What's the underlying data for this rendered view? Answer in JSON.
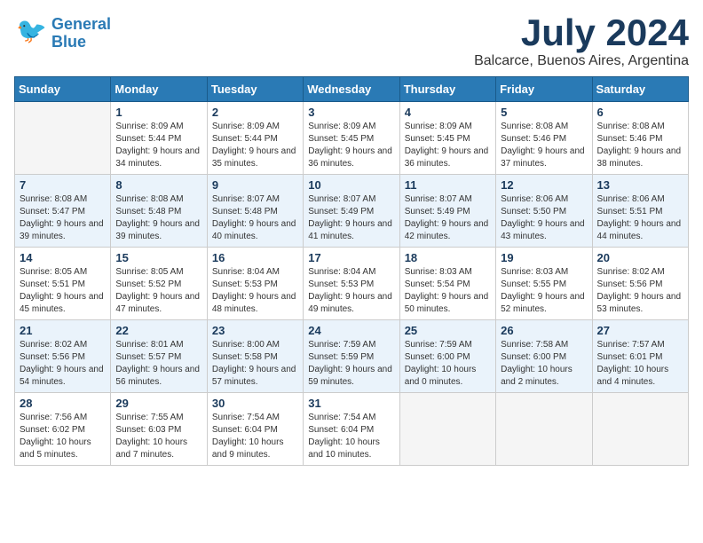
{
  "header": {
    "logo_line1": "General",
    "logo_line2": "Blue",
    "month": "July 2024",
    "location": "Balcarce, Buenos Aires, Argentina"
  },
  "weekdays": [
    "Sunday",
    "Monday",
    "Tuesday",
    "Wednesday",
    "Thursday",
    "Friday",
    "Saturday"
  ],
  "weeks": [
    [
      {
        "day": "",
        "sunrise": "",
        "sunset": "",
        "daylight": ""
      },
      {
        "day": "1",
        "sunrise": "Sunrise: 8:09 AM",
        "sunset": "Sunset: 5:44 PM",
        "daylight": "Daylight: 9 hours and 34 minutes."
      },
      {
        "day": "2",
        "sunrise": "Sunrise: 8:09 AM",
        "sunset": "Sunset: 5:44 PM",
        "daylight": "Daylight: 9 hours and 35 minutes."
      },
      {
        "day": "3",
        "sunrise": "Sunrise: 8:09 AM",
        "sunset": "Sunset: 5:45 PM",
        "daylight": "Daylight: 9 hours and 36 minutes."
      },
      {
        "day": "4",
        "sunrise": "Sunrise: 8:09 AM",
        "sunset": "Sunset: 5:45 PM",
        "daylight": "Daylight: 9 hours and 36 minutes."
      },
      {
        "day": "5",
        "sunrise": "Sunrise: 8:08 AM",
        "sunset": "Sunset: 5:46 PM",
        "daylight": "Daylight: 9 hours and 37 minutes."
      },
      {
        "day": "6",
        "sunrise": "Sunrise: 8:08 AM",
        "sunset": "Sunset: 5:46 PM",
        "daylight": "Daylight: 9 hours and 38 minutes."
      }
    ],
    [
      {
        "day": "7",
        "sunrise": "Sunrise: 8:08 AM",
        "sunset": "Sunset: 5:47 PM",
        "daylight": "Daylight: 9 hours and 39 minutes."
      },
      {
        "day": "8",
        "sunrise": "Sunrise: 8:08 AM",
        "sunset": "Sunset: 5:48 PM",
        "daylight": "Daylight: 9 hours and 39 minutes."
      },
      {
        "day": "9",
        "sunrise": "Sunrise: 8:07 AM",
        "sunset": "Sunset: 5:48 PM",
        "daylight": "Daylight: 9 hours and 40 minutes."
      },
      {
        "day": "10",
        "sunrise": "Sunrise: 8:07 AM",
        "sunset": "Sunset: 5:49 PM",
        "daylight": "Daylight: 9 hours and 41 minutes."
      },
      {
        "day": "11",
        "sunrise": "Sunrise: 8:07 AM",
        "sunset": "Sunset: 5:49 PM",
        "daylight": "Daylight: 9 hours and 42 minutes."
      },
      {
        "day": "12",
        "sunrise": "Sunrise: 8:06 AM",
        "sunset": "Sunset: 5:50 PM",
        "daylight": "Daylight: 9 hours and 43 minutes."
      },
      {
        "day": "13",
        "sunrise": "Sunrise: 8:06 AM",
        "sunset": "Sunset: 5:51 PM",
        "daylight": "Daylight: 9 hours and 44 minutes."
      }
    ],
    [
      {
        "day": "14",
        "sunrise": "Sunrise: 8:05 AM",
        "sunset": "Sunset: 5:51 PM",
        "daylight": "Daylight: 9 hours and 45 minutes."
      },
      {
        "day": "15",
        "sunrise": "Sunrise: 8:05 AM",
        "sunset": "Sunset: 5:52 PM",
        "daylight": "Daylight: 9 hours and 47 minutes."
      },
      {
        "day": "16",
        "sunrise": "Sunrise: 8:04 AM",
        "sunset": "Sunset: 5:53 PM",
        "daylight": "Daylight: 9 hours and 48 minutes."
      },
      {
        "day": "17",
        "sunrise": "Sunrise: 8:04 AM",
        "sunset": "Sunset: 5:53 PM",
        "daylight": "Daylight: 9 hours and 49 minutes."
      },
      {
        "day": "18",
        "sunrise": "Sunrise: 8:03 AM",
        "sunset": "Sunset: 5:54 PM",
        "daylight": "Daylight: 9 hours and 50 minutes."
      },
      {
        "day": "19",
        "sunrise": "Sunrise: 8:03 AM",
        "sunset": "Sunset: 5:55 PM",
        "daylight": "Daylight: 9 hours and 52 minutes."
      },
      {
        "day": "20",
        "sunrise": "Sunrise: 8:02 AM",
        "sunset": "Sunset: 5:56 PM",
        "daylight": "Daylight: 9 hours and 53 minutes."
      }
    ],
    [
      {
        "day": "21",
        "sunrise": "Sunrise: 8:02 AM",
        "sunset": "Sunset: 5:56 PM",
        "daylight": "Daylight: 9 hours and 54 minutes."
      },
      {
        "day": "22",
        "sunrise": "Sunrise: 8:01 AM",
        "sunset": "Sunset: 5:57 PM",
        "daylight": "Daylight: 9 hours and 56 minutes."
      },
      {
        "day": "23",
        "sunrise": "Sunrise: 8:00 AM",
        "sunset": "Sunset: 5:58 PM",
        "daylight": "Daylight: 9 hours and 57 minutes."
      },
      {
        "day": "24",
        "sunrise": "Sunrise: 7:59 AM",
        "sunset": "Sunset: 5:59 PM",
        "daylight": "Daylight: 9 hours and 59 minutes."
      },
      {
        "day": "25",
        "sunrise": "Sunrise: 7:59 AM",
        "sunset": "Sunset: 6:00 PM",
        "daylight": "Daylight: 10 hours and 0 minutes."
      },
      {
        "day": "26",
        "sunrise": "Sunrise: 7:58 AM",
        "sunset": "Sunset: 6:00 PM",
        "daylight": "Daylight: 10 hours and 2 minutes."
      },
      {
        "day": "27",
        "sunrise": "Sunrise: 7:57 AM",
        "sunset": "Sunset: 6:01 PM",
        "daylight": "Daylight: 10 hours and 4 minutes."
      }
    ],
    [
      {
        "day": "28",
        "sunrise": "Sunrise: 7:56 AM",
        "sunset": "Sunset: 6:02 PM",
        "daylight": "Daylight: 10 hours and 5 minutes."
      },
      {
        "day": "29",
        "sunrise": "Sunrise: 7:55 AM",
        "sunset": "Sunset: 6:03 PM",
        "daylight": "Daylight: 10 hours and 7 minutes."
      },
      {
        "day": "30",
        "sunrise": "Sunrise: 7:54 AM",
        "sunset": "Sunset: 6:04 PM",
        "daylight": "Daylight: 10 hours and 9 minutes."
      },
      {
        "day": "31",
        "sunrise": "Sunrise: 7:54 AM",
        "sunset": "Sunset: 6:04 PM",
        "daylight": "Daylight: 10 hours and 10 minutes."
      },
      {
        "day": "",
        "sunrise": "",
        "sunset": "",
        "daylight": ""
      },
      {
        "day": "",
        "sunrise": "",
        "sunset": "",
        "daylight": ""
      },
      {
        "day": "",
        "sunrise": "",
        "sunset": "",
        "daylight": ""
      }
    ]
  ]
}
